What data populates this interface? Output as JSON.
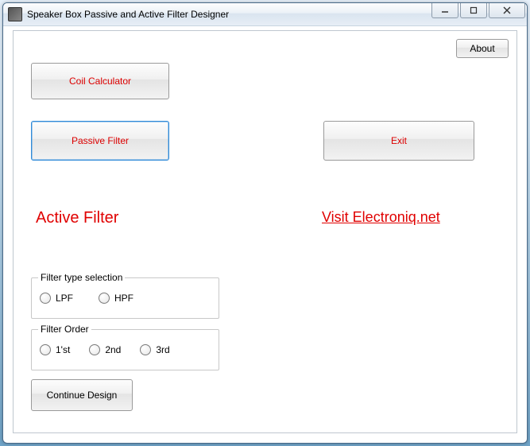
{
  "window": {
    "title": "Speaker Box Passive and Active Filter Designer"
  },
  "about": {
    "label": "About"
  },
  "buttons": {
    "coil": "Coil Calculator",
    "passive": "Passive Filter",
    "exit": "Exit",
    "continue": "Continue Design"
  },
  "heading": "Active Filter",
  "link": {
    "text": "Visit Electroniq.net"
  },
  "groups": {
    "type": {
      "legend": "Filter type selection",
      "options": [
        "LPF",
        "HPF"
      ]
    },
    "order": {
      "legend": "Filter Order",
      "options": [
        "1'st",
        "2nd",
        "3rd"
      ]
    }
  },
  "win_controls": {
    "min": "—",
    "max": "▢",
    "close": "✕"
  }
}
